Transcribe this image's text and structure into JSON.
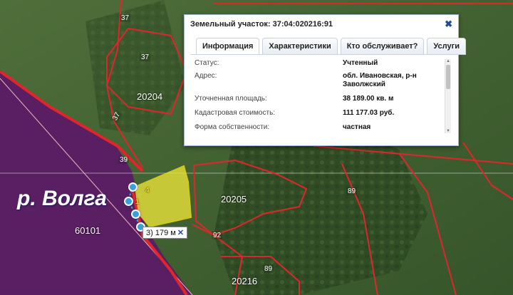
{
  "popup": {
    "title": "Земельный участок: 37:04:020216:91",
    "tabs": [
      {
        "label": "Информация",
        "active": true
      },
      {
        "label": "Характеристики",
        "active": false
      },
      {
        "label": "Кто обслуживает?",
        "active": false
      },
      {
        "label": "Услуги",
        "active": false
      }
    ],
    "rows": [
      {
        "key": "Статус:",
        "value": "Учтенный"
      },
      {
        "key": "Адрес:",
        "value": "обл. Ивановская, р-н Заволжский"
      },
      {
        "key": "Уточненная площадь:",
        "value": "38 189.00 кв. м"
      },
      {
        "key": "Кадастровая стоимость:",
        "value": "111 177.03 руб."
      },
      {
        "key": "Форма собственности:",
        "value": "частная"
      }
    ]
  },
  "map": {
    "river_label": "р. Волга",
    "water_parcel": "60101",
    "parcel_labels": [
      "20204",
      "20205",
      "20216"
    ],
    "road_labels": [
      "37",
      "37",
      "37",
      "39",
      "89",
      "89",
      "92"
    ],
    "segment_labels": [
      "4",
      "1"
    ],
    "measurement": {
      "text": "3) 179 м",
      "close": "✕"
    }
  },
  "colors": {
    "water": "#5a1f63",
    "parcel_highlight": "#e8e23a",
    "boundary": "#e0262b"
  }
}
